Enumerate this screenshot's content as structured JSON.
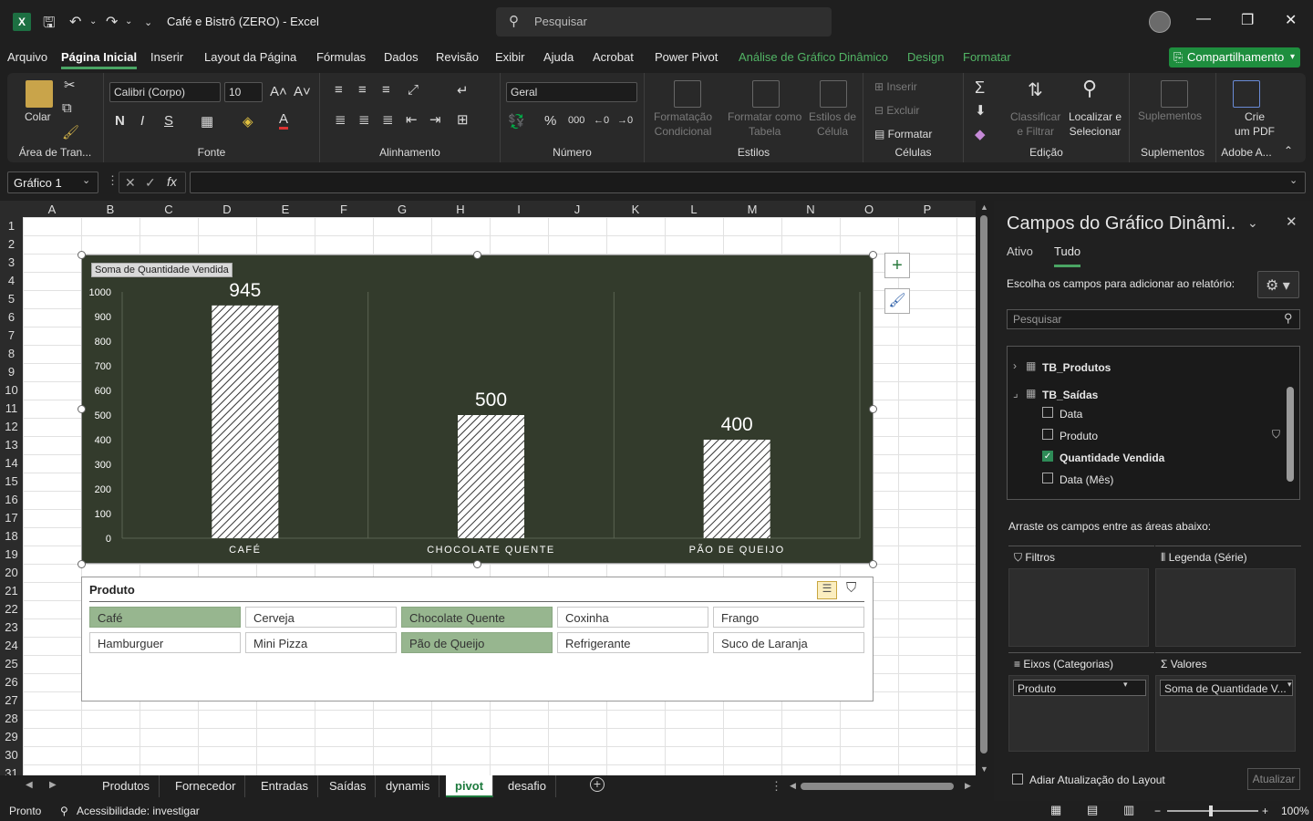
{
  "titlebar": {
    "title": "Café e Bistrô (ZERO)  -  Excel",
    "search_placeholder": "Pesquisar",
    "minimize": "—",
    "restore": "❐",
    "close": "✕"
  },
  "menu": {
    "items": [
      "Arquivo",
      "Página Inicial",
      "Inserir",
      "Layout da Página",
      "Fórmulas",
      "Dados",
      "Revisão",
      "Exibir",
      "Ajuda",
      "Acrobat",
      "Power Pivot",
      "Análise de Gráfico Dinâmico",
      "Design",
      "Formatar"
    ],
    "share": "Compartilhamento"
  },
  "ribbon": {
    "clipboard": {
      "paste": "Colar",
      "label": "Área de Tran..."
    },
    "font": {
      "name": "Calibri (Corpo)",
      "size": "10",
      "bold": "N",
      "italic": "I",
      "underline": "S",
      "label": "Fonte"
    },
    "alignment": {
      "label": "Alinhamento"
    },
    "number": {
      "format": "Geral",
      "label": "Número"
    },
    "styles": {
      "cond": "Formatação\nCondicional",
      "table": "Formatar como\nTabela",
      "cell": "Estilos de\nCélula",
      "label": "Estilos"
    },
    "cells": {
      "insert": "Inserir",
      "delete": "Excluir",
      "format": "Formatar",
      "label": "Células"
    },
    "editing": {
      "sort": "Classificar\ne Filtrar",
      "find": "Localizar e\nSelecionar",
      "label": "Edição"
    },
    "addins": {
      "btn": "Suplementos",
      "label": "Suplementos"
    },
    "adobe": {
      "btn": "Crie\num PDF",
      "label": "Adobe A..."
    }
  },
  "formula_bar": {
    "name_box": "Gráfico 1",
    "formula": ""
  },
  "columns": [
    "A",
    "B",
    "C",
    "D",
    "E",
    "F",
    "G",
    "H",
    "I",
    "J",
    "K",
    "L",
    "M",
    "N",
    "O",
    "P"
  ],
  "rows": [
    "1",
    "2",
    "3",
    "4",
    "5",
    "6",
    "7",
    "8",
    "9",
    "10",
    "11",
    "12",
    "13",
    "14",
    "15",
    "16",
    "17",
    "18",
    "19",
    "20",
    "21",
    "22",
    "23",
    "24",
    "25",
    "26",
    "27",
    "28",
    "29",
    "30",
    "31"
  ],
  "chart_data": {
    "type": "bar",
    "series_label": "Soma de Quantidade Vendida",
    "categories": [
      "CAFÉ",
      "CHOCOLATE QUENTE",
      "PÃO DE QUEIJO"
    ],
    "values": [
      945,
      500,
      400
    ],
    "ylim": [
      0,
      1000
    ],
    "yticks": [
      0,
      100,
      200,
      300,
      400,
      500,
      600,
      700,
      800,
      900,
      1000
    ],
    "background": "#333b2c",
    "bar_pattern": "diagonal-stripes",
    "legend": "none",
    "grid": "vertical-category-lines"
  },
  "slicer": {
    "title": "Produto",
    "items": [
      {
        "label": "Café",
        "selected": true
      },
      {
        "label": "Cerveja",
        "selected": false
      },
      {
        "label": "Chocolate Quente",
        "selected": true
      },
      {
        "label": "Coxinha",
        "selected": false
      },
      {
        "label": "Frango",
        "selected": false
      },
      {
        "label": "Hamburguer",
        "selected": false
      },
      {
        "label": "Mini Pizza",
        "selected": false
      },
      {
        "label": "Pão de Queijo",
        "selected": true
      },
      {
        "label": "Refrigerante",
        "selected": false
      },
      {
        "label": "Suco de Laranja",
        "selected": false
      }
    ],
    "selected_color": "#97b68f"
  },
  "pane": {
    "title": "Campos do Gráfico Dinâmi..",
    "tabs": [
      "Ativo",
      "Tudo"
    ],
    "instruction": "Escolha os campos para adicionar ao relatório:",
    "search_placeholder": "Pesquisar",
    "tables": [
      {
        "name": "TB_Produtos",
        "expanded": false
      },
      {
        "name": "TB_Saídas",
        "expanded": true
      }
    ],
    "fields": [
      {
        "label": "Data",
        "checked": false
      },
      {
        "label": "Produto",
        "checked": false
      },
      {
        "label": "Quantidade Vendida",
        "checked": true
      },
      {
        "label": "Data (Mês)",
        "checked": false
      }
    ],
    "drag_text": "Arraste os campos entre as áreas abaixo:",
    "areas": {
      "filters": "Filtros",
      "legend": "Legenda (Série)",
      "axis": "Eixos (Categorias)",
      "values": "Valores",
      "axis_item": "Produto",
      "values_item": "Soma de Quantidade V..."
    },
    "defer": "Adiar Atualização do Layout",
    "update": "Atualizar"
  },
  "sheet_tabs": [
    "Produtos",
    "Fornecedor",
    "Entradas",
    "Saídas",
    "dynamis",
    "pivot",
    "desafio"
  ],
  "active_tab": "pivot",
  "status": {
    "ready": "Pronto",
    "accessibility": "Acessibilidade: investigar",
    "zoom": "100%"
  }
}
